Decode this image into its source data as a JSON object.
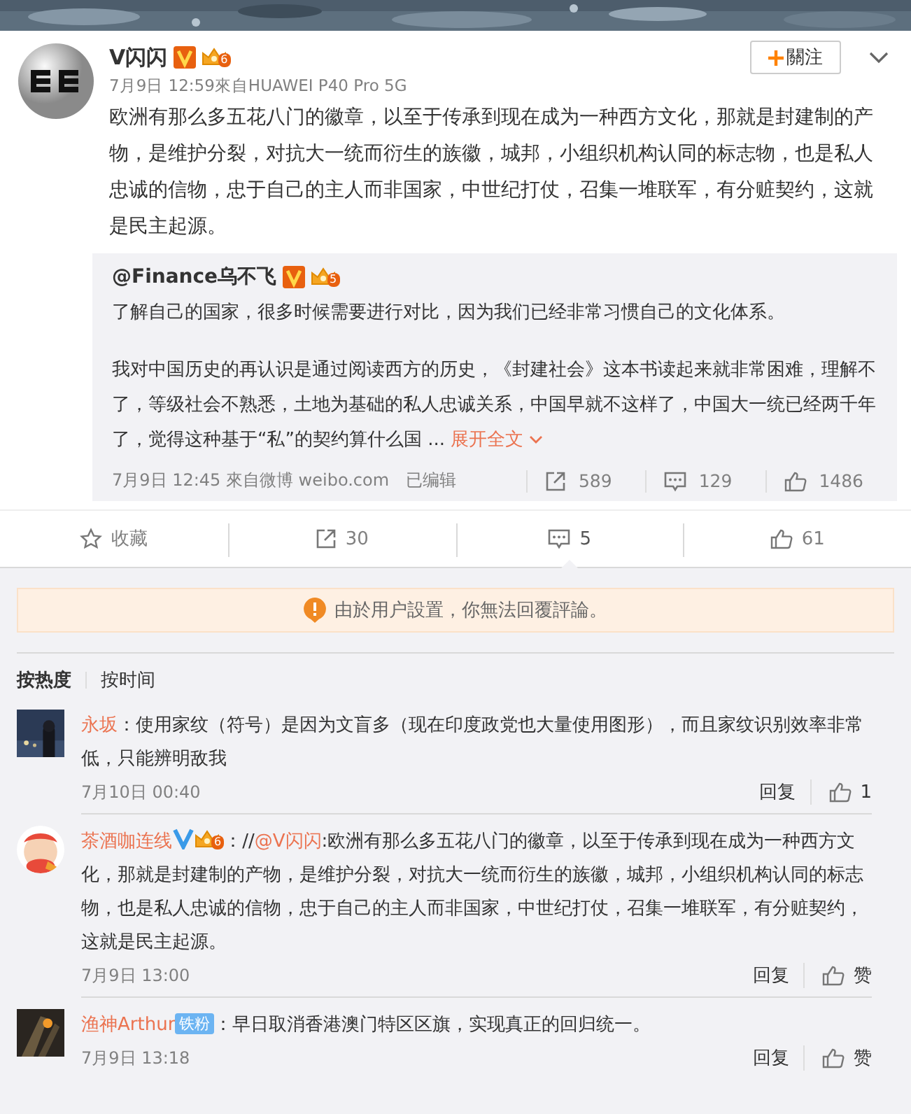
{
  "post": {
    "author": "V闪闪",
    "badges": [
      {
        "kind": "verified"
      },
      {
        "kind": "vip",
        "level": "6"
      }
    ],
    "follow_button": "關注",
    "meta": "7月9日 12:59來自HUAWEI P40 Pro 5G",
    "text": "欧洲有那么多五花八门的徽章，以至于传承到现在成为一种西方文化，那就是封建制的产物，是维护分裂，对抗大一统而衍生的族徽，城邦，小组织机构认同的标志物，也是私人忠诚的信物，忠于自己的主人而非国家，中世纪打仗，召集一堆联军，有分赃契约，这就是民主起源。",
    "repost": {
      "author": "@Finance乌不飞",
      "badges": [
        {
          "kind": "verified"
        },
        {
          "kind": "vip",
          "level": "5"
        }
      ],
      "paragraphs": [
        "了解自己的国家，很多时候需要进行对比，因为我们已经非常习惯自己的文化体系。",
        "我对中国历史的再认识是通过阅读西方的历史，《封建社会》这本书读起来就非常困难，理解不了，等级社会不熟悉，土地为基础的私人忠诚关系，中国早就不这样了，中国大一统已经两千年了，觉得这种基于“私”的契约算什么国 ..."
      ],
      "more_link": "展开全文",
      "meta": "7月9日 12:45 來自微博 weibo.com",
      "edited": "已编辑",
      "stats": [
        {
          "kind": "share",
          "count": "589"
        },
        {
          "kind": "comment",
          "count": "129"
        },
        {
          "kind": "like",
          "count": "1486"
        }
      ]
    }
  },
  "actions": [
    {
      "kind": "favorite",
      "label": "收藏",
      "selected": false
    },
    {
      "kind": "share",
      "label": "30",
      "selected": false
    },
    {
      "kind": "comment",
      "label": "5",
      "selected": true
    },
    {
      "kind": "like",
      "label": "61",
      "selected": false
    }
  ],
  "notice": "由於用户設置，你無法回覆評論。",
  "sort_tabs": [
    {
      "label": "按热度",
      "selected": true
    },
    {
      "label": "按时间",
      "selected": false
    }
  ],
  "comments": [
    {
      "author": "永坂",
      "text": "：使用家纹（符号）是因为文盲多（现在印度政党也大量使用图形），而且家纹识别效率非常低，只能辨明敌我",
      "time": "7月10日 00:40",
      "reply": "回复",
      "likes": "1"
    },
    {
      "author": "茶酒咖连线",
      "badges": [
        {
          "kind": "verified_blue"
        },
        {
          "kind": "vip",
          "level": "6"
        }
      ],
      "prefix": "：//",
      "mention": "@V闪闪",
      "text": ":欧洲有那么多五花八门的徽章，以至于传承到现在成为一种西方文化，那就是封建制的产物，是维护分裂，对抗大一统而衍生的族徽，城邦，小组织机构认同的标志物，也是私人忠诚的信物，忠于自己的主人而非国家，中世纪打仗，召集一堆联军，有分赃契约，这就是民主起源。",
      "time": "7月9日 13:00",
      "reply": "回复",
      "likes": "赞"
    },
    {
      "author": "渔神Arthur",
      "badges": [
        {
          "kind": "fan",
          "label": "铁粉"
        }
      ],
      "text": "：早日取消香港澳门特区区旗，实现真正的回归统一。",
      "time": "7月9日 13:18",
      "reply": "回复",
      "likes": "赞"
    }
  ]
}
